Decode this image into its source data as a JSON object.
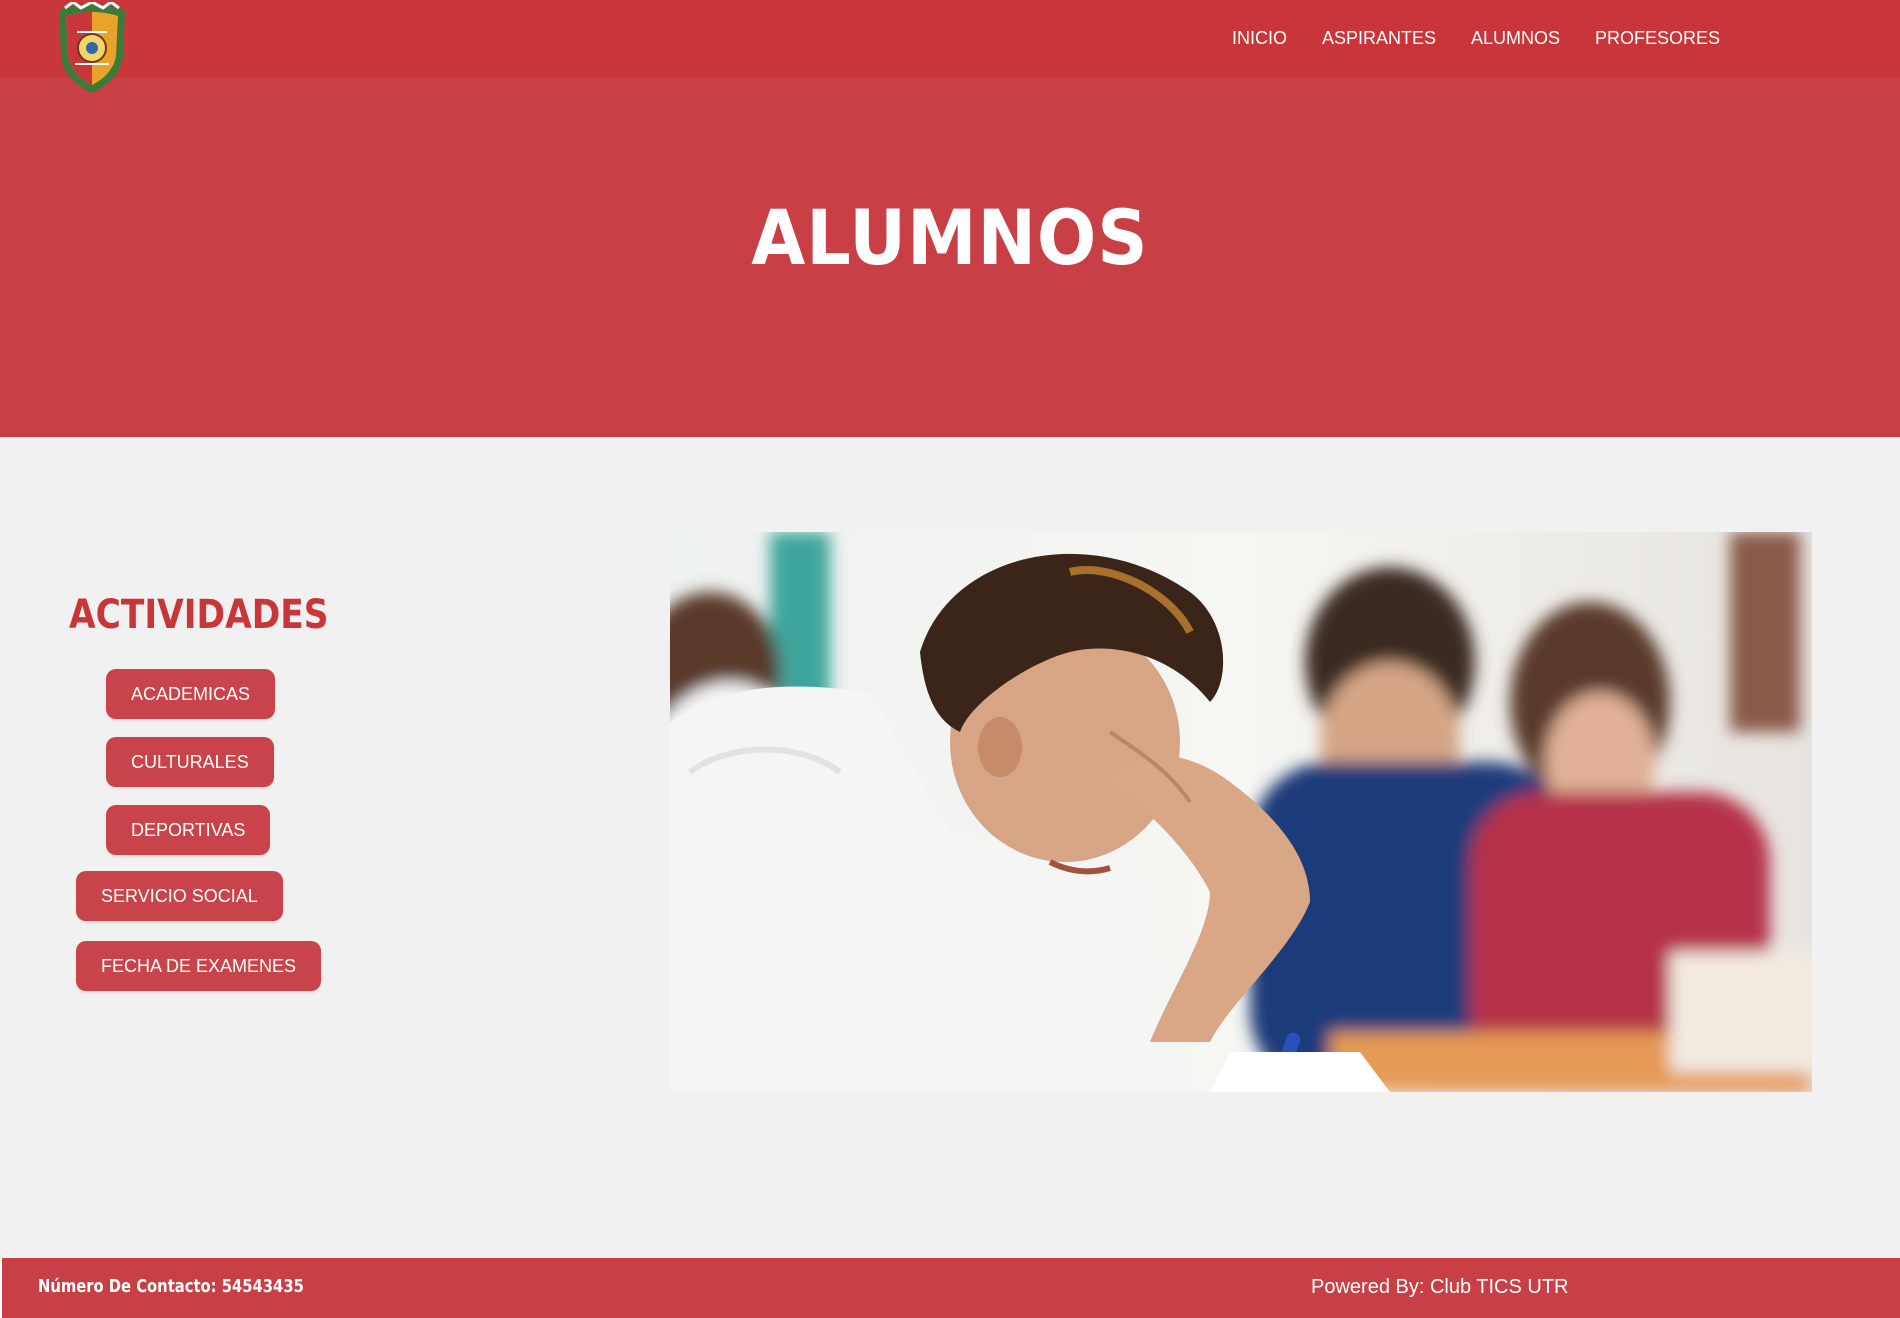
{
  "header": {
    "logo": "university-crest-logo",
    "nav": [
      "INICIO",
      "ASPIRANTES",
      "ALUMNOS",
      "PROFESORES"
    ]
  },
  "hero": {
    "title": "ALUMNOS"
  },
  "activities": {
    "title": "ACTIVIDADES",
    "buttons": [
      "ACADEMICAS",
      "CULTURALES",
      "DEPORTIVAS",
      "SERVICIO SOCIAL",
      "FECHA DE EXAMENES"
    ]
  },
  "main_image": {
    "description_icon": "students-taking-exam-photo"
  },
  "footer": {
    "contact": "Número De Contacto: 54543435",
    "powered": "Powered By: Club TICS UTR"
  },
  "colors": {
    "primary_red": "#c8363a",
    "hero_red": "#c84045",
    "page_bg": "#f0f1f0",
    "button_red": "#c8434a"
  }
}
